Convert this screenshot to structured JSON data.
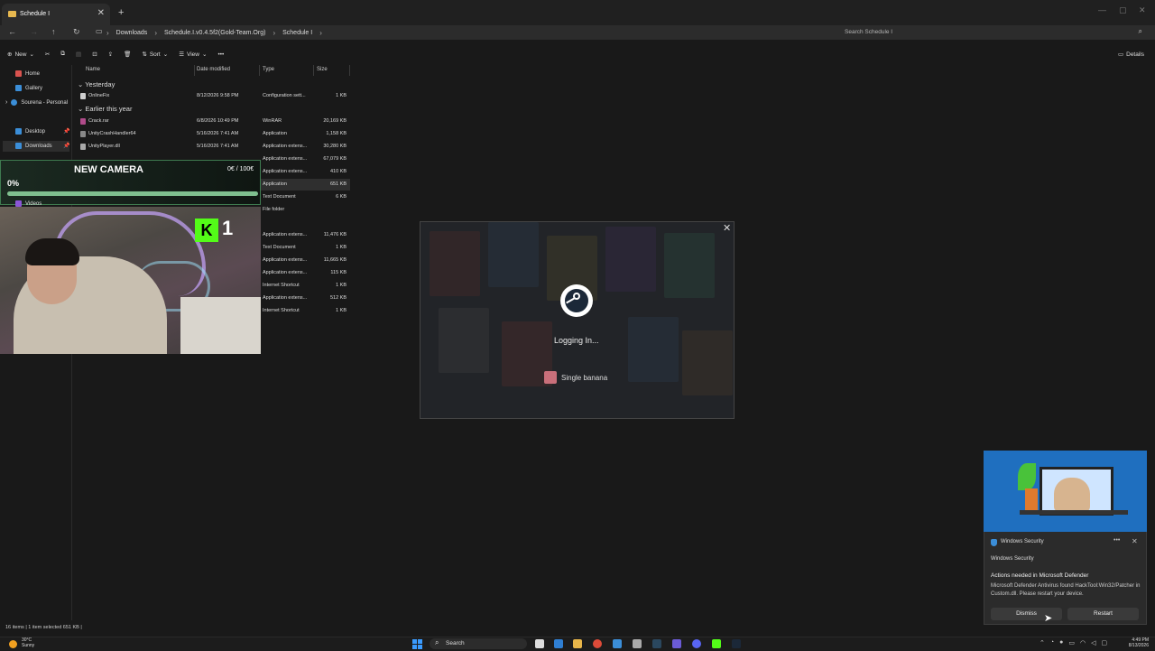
{
  "window": {
    "tab_title": "Schedule I",
    "new_tab": "+",
    "close": "✕"
  },
  "address": {
    "crumbs": [
      "Downloads",
      "Schedule.I.v0.4.5f2(Gold-Team.Org)",
      "Schedule I"
    ],
    "search_placeholder": "Search Schedule I"
  },
  "toolbar": {
    "new_label": "New",
    "sort_label": "Sort",
    "view_label": "View",
    "more_label": "•••",
    "details_label": "Details"
  },
  "sidebar": {
    "items": [
      {
        "label": "Home",
        "color": "#d9534f"
      },
      {
        "label": "Gallery",
        "color": "#3b8ed8"
      },
      {
        "label": "Sourena - Personal",
        "color": "#3b8ed8"
      },
      {
        "label": "Desktop",
        "color": "#3b8ed8"
      },
      {
        "label": "Downloads",
        "color": "#3b8ed8"
      },
      {
        "label": "Videos",
        "color": "#8a56d6"
      }
    ]
  },
  "columns": {
    "name": "Name",
    "date": "Date modified",
    "type": "Type",
    "size": "Size"
  },
  "groups": {
    "yesterday": "Yesterday",
    "earlier": "Earlier this year"
  },
  "files": [
    {
      "name": "OnlineFix",
      "date": "8/12/2026 9:58 PM",
      "type": "Configuration sett...",
      "size": "1 KB"
    },
    {
      "name": "Crack.rar",
      "date": "6/8/2026 10:49 PM",
      "type": "WinRAR",
      "size": "20,169 KB"
    },
    {
      "name": "UnityCrashHandler64",
      "date": "5/16/2026 7:41 AM",
      "type": "Application",
      "size": "1,158 KB"
    },
    {
      "name": "UnityPlayer.dll",
      "date": "5/16/2026 7:41 AM",
      "type": "Application extens...",
      "size": "30,280 KB"
    }
  ],
  "files_partial": [
    {
      "type": "Application extens...",
      "size": "67,079 KB"
    },
    {
      "type": "Application extens...",
      "size": "410 KB"
    },
    {
      "type": "Application",
      "size": "651 KB"
    },
    {
      "type": "Text Document",
      "size": "6 KB"
    },
    {
      "type": "File folder",
      "size": ""
    },
    {
      "type": "Application extens...",
      "size": "11,476 KB"
    },
    {
      "type": "Text Document",
      "size": "1 KB"
    },
    {
      "type": "Application extens...",
      "size": "11,665 KB"
    },
    {
      "type": "Application extens...",
      "size": "115 KB"
    },
    {
      "type": "Internet Shortcut",
      "size": "1 KB"
    },
    {
      "type": "Application extens...",
      "size": "512 KB"
    },
    {
      "type": "Internet Shortcut",
      "size": "1 KB"
    }
  ],
  "status_bar": "16 items  |  1 item selected  651 KB  |",
  "overlay": {
    "title": "NEW CAMERA",
    "amount": "0€ / 100€",
    "percent_label": "0%",
    "progress": 0
  },
  "kick": {
    "badge": "K",
    "count": "1"
  },
  "steam": {
    "status": "Logging In...",
    "username": "Single banana",
    "close": "✕"
  },
  "notification": {
    "app": "Windows Security",
    "subtitle": "Windows Security",
    "heading": "Actions needed in Microsoft Defender",
    "body": "Microsoft Defender Antivirus found HackTool:Win32/Patcher in Custom.dll. Please restart your device.",
    "dismiss_label": "Dismiss",
    "restart_label": "Restart",
    "more": "•••",
    "close": "✕"
  },
  "taskbar": {
    "weather_temp": "30°C",
    "weather_desc": "Sunny",
    "search_label": "Search",
    "time": "4:49 PM",
    "date": "8/13/2026"
  }
}
